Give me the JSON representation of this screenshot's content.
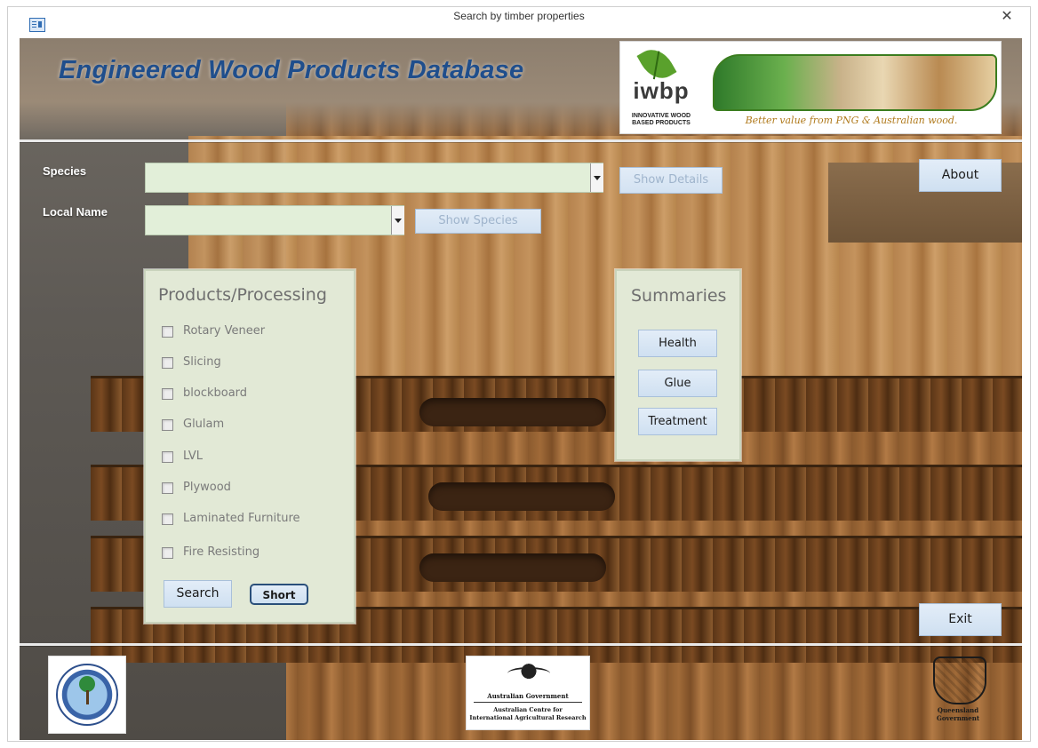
{
  "window": {
    "title": "Search by timber properties",
    "close_glyph": "✕"
  },
  "app_title": "Engineered Wood Products Database",
  "banner": {
    "brand": "iwbp",
    "subtitle_line1": "INNOVATIVE WOOD",
    "subtitle_line2": "BASED PRODUCTS",
    "tagline": "Better value from PNG & Australian wood."
  },
  "search": {
    "species_label": "Species",
    "species_value": "",
    "show_details": "Show Details",
    "local_name_label": "Local Name",
    "local_name_value": "",
    "show_species": "Show Species",
    "about": "About"
  },
  "products": {
    "title": "Products/Processing",
    "items": [
      {
        "label": "Rotary Veneer",
        "checked": false
      },
      {
        "label": "Slicing",
        "checked": false
      },
      {
        "label": "blockboard",
        "checked": false
      },
      {
        "label": "Glulam",
        "checked": false
      },
      {
        "label": "LVL",
        "checked": false
      },
      {
        "label": "Plywood",
        "checked": false
      },
      {
        "label": "Laminated Furniture",
        "checked": false
      },
      {
        "label": "Fire Resisting",
        "checked": false
      }
    ],
    "search_button": "Search",
    "short_button": "Short"
  },
  "summaries": {
    "title": "Summaries",
    "buttons": [
      "Health",
      "Glue",
      "Treatment"
    ]
  },
  "exit": "Exit",
  "footer": {
    "aus_gov": "Australian Government",
    "aciar_line1": "Australian Centre for",
    "aciar_line2": "International Agricultural Research",
    "qld_line1": "Queensland",
    "qld_line2": "Government"
  },
  "colors": {
    "title_blue": "#1f4e8c",
    "field_green": "#e2efd9",
    "panel_bg": "#e2e9d6",
    "button_blue": "#cfe0f1"
  }
}
